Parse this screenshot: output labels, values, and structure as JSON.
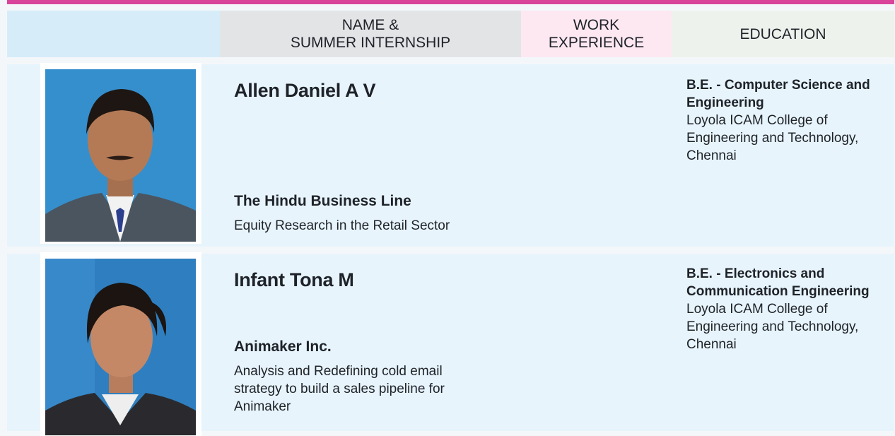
{
  "header": {
    "col_name_line1": "NAME &",
    "col_name_line2": "SUMMER INTERNSHIP",
    "col_work_line1": "WORK",
    "col_work_line2": "EXPERIENCE",
    "col_education": "EDUCATION"
  },
  "students": [
    {
      "name": "Allen Daniel A V",
      "internship_company": "The Hindu Business Line",
      "internship_project": "Equity Research in the Retail Sector",
      "work_experience": "",
      "degree": "B.E. - Computer Science and Engineering",
      "college": "Loyola ICAM College of Engineering and Technology, Chennai"
    },
    {
      "name": "Infant Tona M",
      "internship_company": "Animaker Inc.",
      "internship_project": "Analysis and Redefining cold email strategy to build a sales pipeline for Animaker",
      "work_experience": "",
      "degree": "B.E. - Electronics and Communication Engineering",
      "college": "Loyola ICAM College of Engineering and Technology, Chennai"
    }
  ],
  "colors": {
    "accent_bar": "#d9449a",
    "row_background": "#e7f4fb",
    "header_name": "#e3e4e6",
    "header_work": "#fde8f1",
    "header_education": "#edf3ec"
  }
}
